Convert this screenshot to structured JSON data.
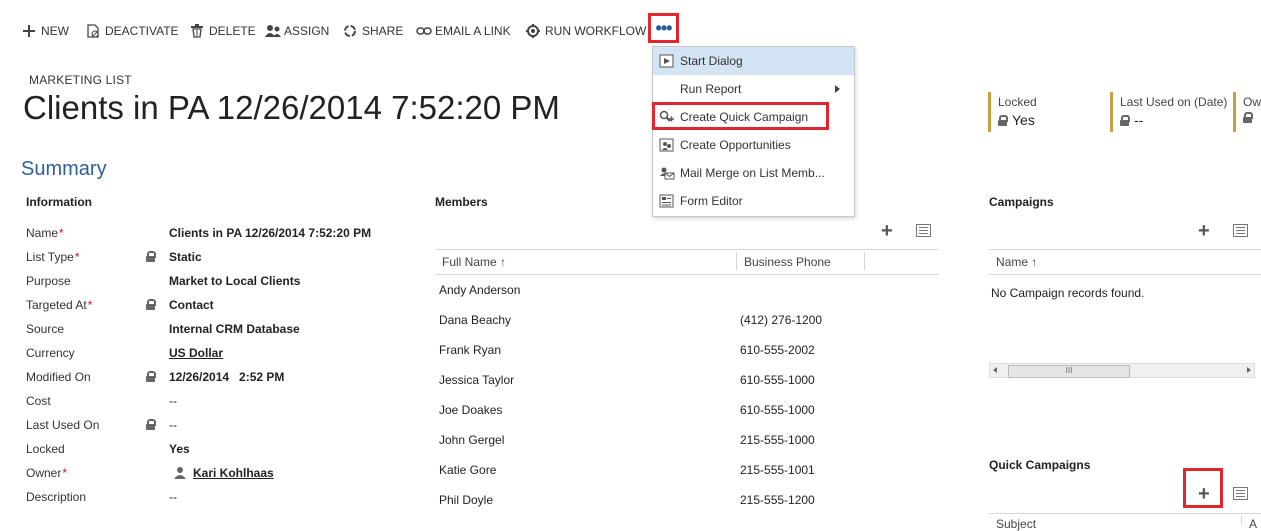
{
  "toolbar": {
    "new": "NEW",
    "deactivate": "DEACTIVATE",
    "delete": "DELETE",
    "assign": "ASSIGN",
    "share": "SHARE",
    "email_link": "EMAIL A LINK",
    "run_workflow": "RUN WORKFLOW",
    "more": "•••"
  },
  "menu": {
    "items": [
      {
        "label": "Start Dialog",
        "icon": "start-dialog-icon"
      },
      {
        "label": "Run Report",
        "icon": "run-report-icon"
      },
      {
        "label": "Create Quick Campaign",
        "icon": "quick-campaign-icon"
      },
      {
        "label": "Create Opportunities",
        "icon": "opportunities-icon"
      },
      {
        "label": "Mail Merge on List Memb...",
        "icon": "mail-merge-icon"
      },
      {
        "label": "Form Editor",
        "icon": "form-editor-icon"
      }
    ]
  },
  "header": {
    "entity_type": "MARKETING LIST",
    "title": "Clients in PA 12/26/2014 7:52:20 PM",
    "fields": [
      {
        "label": "Locked",
        "value": "Yes"
      },
      {
        "label": "Last Used on (Date)",
        "value": "--"
      },
      {
        "label": "Ow",
        "value": ""
      }
    ]
  },
  "summary": "Summary",
  "information": {
    "title": "Information",
    "rows": [
      {
        "label": "Name",
        "value": "Clients in PA 12/26/2014 7:52:20 PM"
      },
      {
        "label": "List Type",
        "value": "Static"
      },
      {
        "label": "Purpose",
        "value": "Market to Local Clients"
      },
      {
        "label": "Targeted At",
        "value": "Contact"
      },
      {
        "label": "Source",
        "value": "Internal CRM Database"
      },
      {
        "label": "Currency",
        "value": "US Dollar"
      },
      {
        "label": "Modified On",
        "value": "12/26/2014   2:52 PM"
      },
      {
        "label": "Cost",
        "value": "--"
      },
      {
        "label": "Last Used On",
        "value": "--"
      },
      {
        "label": "Locked",
        "value": "Yes"
      },
      {
        "label": "Owner",
        "value": "Kari Kohlhaas"
      },
      {
        "label": "Description",
        "value": "--"
      }
    ],
    "required": "*"
  },
  "members": {
    "title": "Members",
    "columns": [
      "Full Name ↑",
      "Business Phone"
    ],
    "rows": [
      {
        "name": "Andy Anderson",
        "phone": ""
      },
      {
        "name": "Dana Beachy",
        "phone": "(412) 276-1200"
      },
      {
        "name": "Frank Ryan",
        "phone": "610-555-2002"
      },
      {
        "name": "Jessica Taylor",
        "phone": "610-555-1000"
      },
      {
        "name": "Joe Doakes",
        "phone": "610-555-1000"
      },
      {
        "name": "John Gergel",
        "phone": "215-555-1000"
      },
      {
        "name": "Katie Gore",
        "phone": "215-555-1001"
      },
      {
        "name": "Phil Doyle",
        "phone": "215-555-1200"
      }
    ]
  },
  "campaigns": {
    "title": "Campaigns",
    "column": "Name ↑",
    "empty": "No Campaign records found.",
    "scroll_thumb": "III"
  },
  "quick_campaigns": {
    "title": "Quick Campaigns",
    "column": "Subject",
    "column2": "A"
  },
  "icons": {
    "add": "+"
  },
  "colors": {
    "accent": "#2e5f98",
    "highlight": "#e3262d",
    "header_bar": "#c9a041",
    "menu_hover": "#d3e4f5"
  }
}
